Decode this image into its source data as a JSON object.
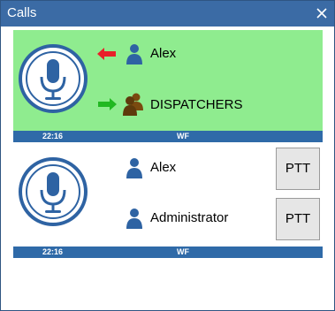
{
  "window": {
    "title": "Calls",
    "titlebar_color": "#3b6ba5"
  },
  "calls": [
    {
      "active": true,
      "background": "#8fec8f",
      "participants": [
        {
          "name": "Alex",
          "direction": "incoming",
          "arrow_color": "#e8202a",
          "icon": "user-icon"
        },
        {
          "name": "DISPATCHERS",
          "direction": "outgoing",
          "arrow_color": "#22b822",
          "icon": "group-icon"
        }
      ],
      "status": {
        "time": "22:16",
        "code": "WF"
      }
    },
    {
      "active": false,
      "background": "#ffffff",
      "participants": [
        {
          "name": "Alex",
          "icon": "user-icon",
          "ptt_label": "PTT"
        },
        {
          "name": "Administrator",
          "icon": "user-icon",
          "ptt_label": "PTT"
        }
      ],
      "status": {
        "time": "22:16",
        "code": "WF"
      }
    }
  ]
}
